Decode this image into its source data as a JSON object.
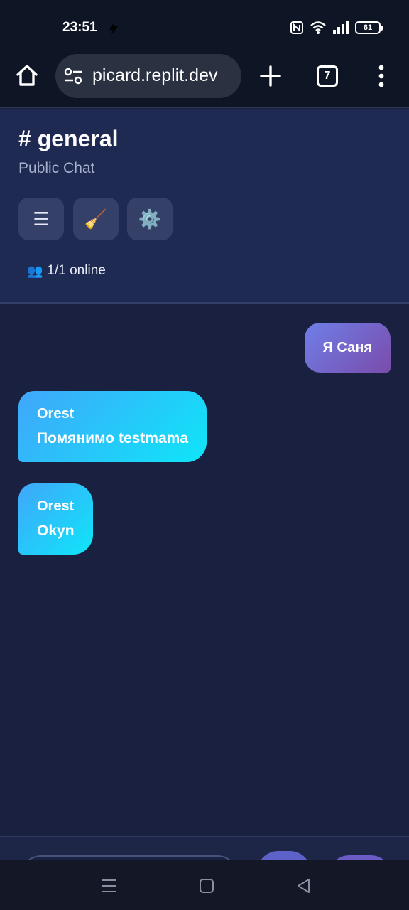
{
  "status_bar": {
    "time": "23:51",
    "battery": "61",
    "icons": [
      "lightning-bolt-icon",
      "nfc-icon",
      "wifi-icon",
      "signal-icon",
      "battery-icon"
    ]
  },
  "browser": {
    "url": "picard.replit.dev",
    "tab_count": "7",
    "icons": [
      "home-icon",
      "site-settings-icon",
      "plus-icon",
      "tabs-icon",
      "more-vert-icon"
    ]
  },
  "chat": {
    "channel_title": "# general",
    "subtitle": "Public Chat",
    "buttons": [
      {
        "icon": "☰",
        "name": "menu-icon"
      },
      {
        "icon": "🧹",
        "name": "broom-icon"
      },
      {
        "icon": "⚙️",
        "name": "gear-icon"
      }
    ],
    "online_icon": "👥",
    "online_text": "1/1 online"
  },
  "messages": [
    {
      "direction": "out",
      "text": "Я Саня"
    },
    {
      "direction": "in",
      "sender": "Orest",
      "text": "Помянимо testmama"
    },
    {
      "direction": "in",
      "sender": "Orest",
      "text": "Okyn"
    }
  ],
  "colors": {
    "background": "#1a2140",
    "header": "#1f2a52",
    "outgoing_bubble": "#7a4cab",
    "incoming_bubble": "#0ee6f8"
  }
}
